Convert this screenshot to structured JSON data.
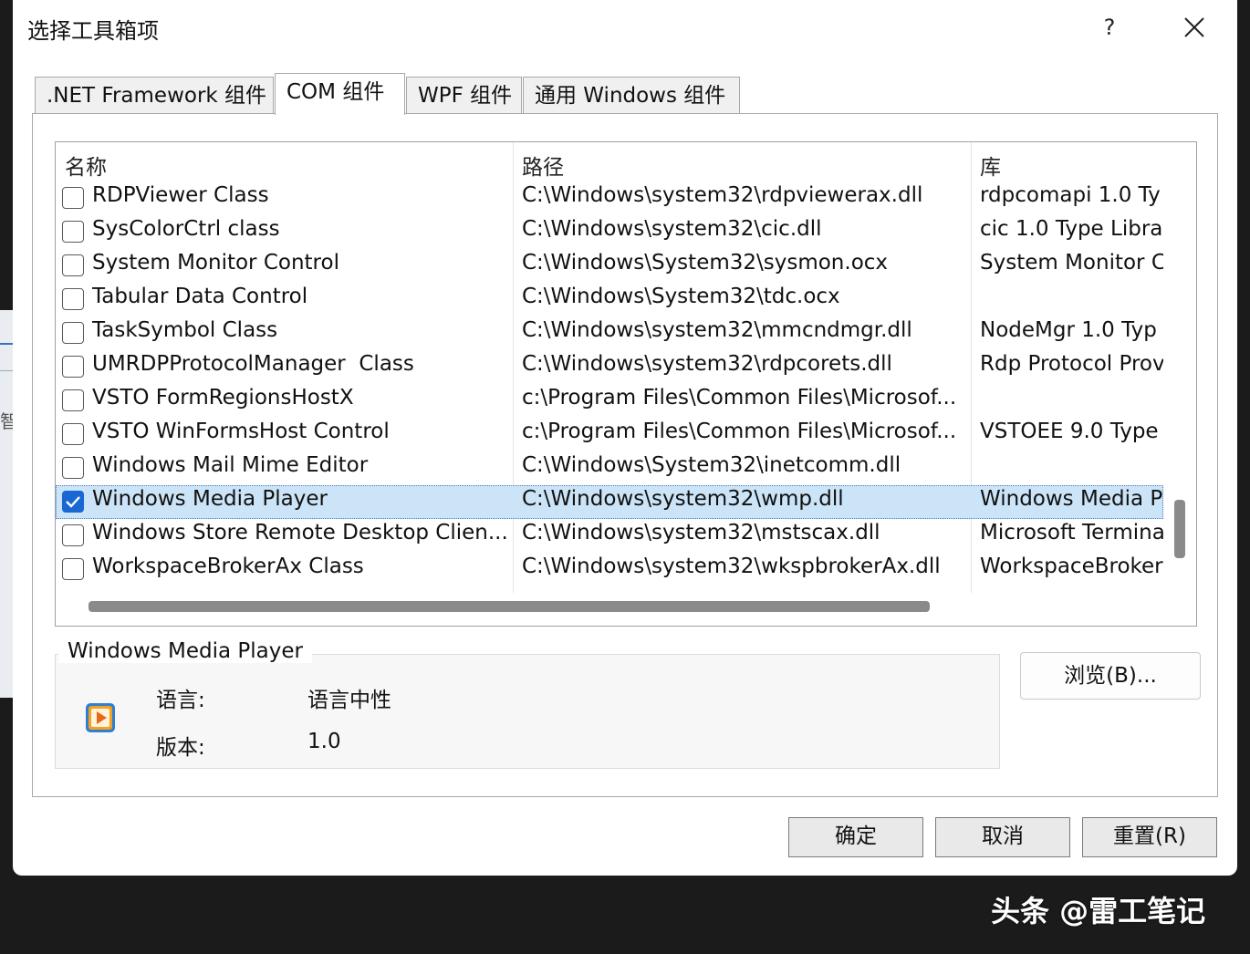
{
  "dialog": {
    "title": "选择工具箱项",
    "help": "?"
  },
  "tabs": [
    {
      "label": ".NET Framework 组件",
      "active": false
    },
    {
      "label": "COM 组件",
      "active": true
    },
    {
      "label": "WPF 组件",
      "active": false
    },
    {
      "label": "通用 Windows 组件",
      "active": false
    }
  ],
  "list": {
    "columns": [
      "名称",
      "路径",
      "库"
    ],
    "rows": [
      {
        "checked": false,
        "selected": false,
        "name": "RDPViewer Class",
        "path": "C:\\Windows\\system32\\rdpviewerax.dll",
        "lib": "rdpcomapi 1.0 Ty"
      },
      {
        "checked": false,
        "selected": false,
        "name": "SysColorCtrl class",
        "path": "C:\\Windows\\system32\\cic.dll",
        "lib": "cic 1.0 Type Libra"
      },
      {
        "checked": false,
        "selected": false,
        "name": "System Monitor Control",
        "path": "C:\\Windows\\System32\\sysmon.ocx",
        "lib": "System Monitor C"
      },
      {
        "checked": false,
        "selected": false,
        "name": "Tabular Data Control",
        "path": "C:\\Windows\\System32\\tdc.ocx",
        "lib": ""
      },
      {
        "checked": false,
        "selected": false,
        "name": "TaskSymbol Class",
        "path": "C:\\Windows\\system32\\mmcndmgr.dll",
        "lib": "NodeMgr 1.0 Typ"
      },
      {
        "checked": false,
        "selected": false,
        "name": "UMRDPProtocolManager  Class",
        "path": "C:\\Windows\\system32\\rdpcorets.dll",
        "lib": "Rdp Protocol Prov"
      },
      {
        "checked": false,
        "selected": false,
        "name": "VSTO FormRegionsHostX",
        "path": "c:\\Program Files\\Common Files\\Microsof...",
        "lib": ""
      },
      {
        "checked": false,
        "selected": false,
        "name": "VSTO WinFormsHost Control",
        "path": "c:\\Program Files\\Common Files\\Microsof...",
        "lib": "VSTOEE 9.0 Type"
      },
      {
        "checked": false,
        "selected": false,
        "name": "Windows Mail Mime Editor",
        "path": "C:\\Windows\\System32\\inetcomm.dll",
        "lib": ""
      },
      {
        "checked": true,
        "selected": true,
        "name": "Windows Media Player",
        "path": "C:\\Windows\\system32\\wmp.dll",
        "lib": "Windows Media P"
      },
      {
        "checked": false,
        "selected": false,
        "name": "Windows Store Remote Desktop Clien...",
        "path": "C:\\Windows\\system32\\mstscax.dll",
        "lib": "Microsoft Termina"
      },
      {
        "checked": false,
        "selected": false,
        "name": "WorkspaceBrokerAx Class",
        "path": "C:\\Windows\\system32\\wkspbrokerAx.dll",
        "lib": "WorkspaceBroker"
      }
    ]
  },
  "details": {
    "title": "Windows Media Player",
    "language_label": "语言:",
    "language_value": "语言中性",
    "version_label": "版本:",
    "version_value": "1.0",
    "icon": "windows-media-player-icon"
  },
  "buttons": {
    "browse": "浏览(B)...",
    "ok": "确定",
    "cancel": "取消",
    "reset": "重置(R)"
  },
  "watermark": "头条 @雷工笔记",
  "colors": {
    "selection": "#cce4f7",
    "checkbox_checked": "#1967d2"
  }
}
